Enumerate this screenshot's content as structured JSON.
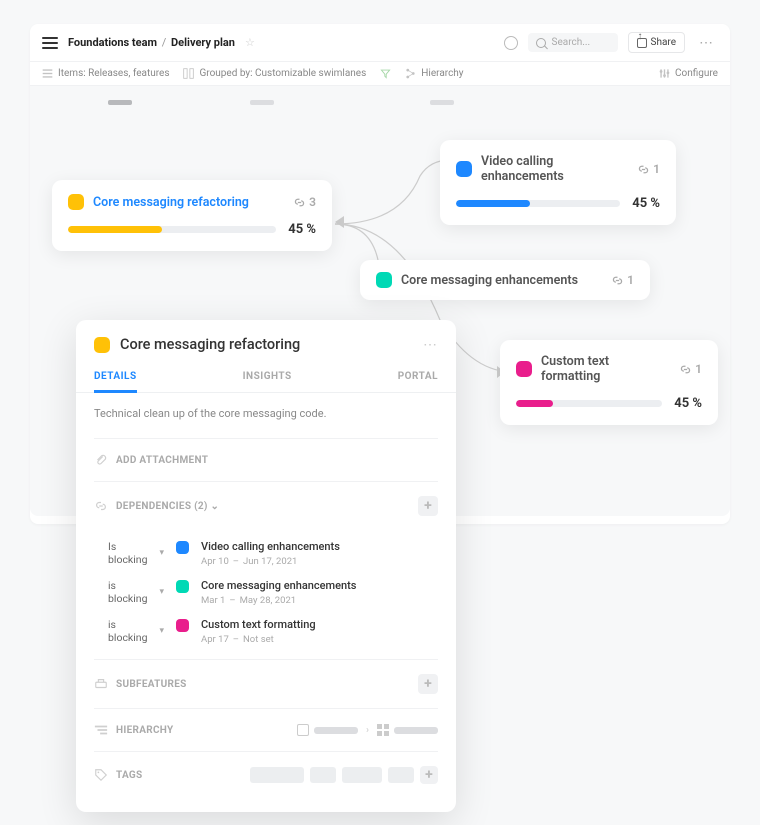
{
  "header": {
    "team": "Foundations team",
    "page": "Delivery plan",
    "search_placeholder": "Search...",
    "share_label": "Share"
  },
  "toolbar": {
    "items_label": "Items: Releases, features",
    "grouped_label": "Grouped by: Customizable swimlanes",
    "hierarchy_label": "Hierarchy",
    "configure_label": "Configure"
  },
  "cards": {
    "core_refactor": {
      "title": "Core messaging refactoring",
      "deps": "3",
      "pct": "45 %",
      "fill": 45
    },
    "video": {
      "title": "Video calling enhancements",
      "deps": "1",
      "pct": "45 %",
      "fill": 45
    },
    "core_enhance": {
      "title": "Core messaging enhancements",
      "deps": "1"
    },
    "custom_text": {
      "title": "Custom text formatting",
      "deps": "1",
      "pct": "45 %",
      "fill": 25
    }
  },
  "panel": {
    "title": "Core messaging refactoring",
    "tabs": {
      "details": "DETAILS",
      "insights": "INSIGHTS",
      "portal": "PORTAL"
    },
    "description": "Technical clean up of the core messaging code.",
    "attach_label": "ADD ATTACHMENT",
    "deps_label": "DEPENDENCIES (2)",
    "subfeatures_label": "SUBFEATURES",
    "hierarchy_label": "HIERARCHY",
    "tags_label": "TAGS",
    "deps": [
      {
        "rel": "Is blocking",
        "color": "blue",
        "name": "Video calling enhancements",
        "start": "Apr 10",
        "end": "Jun 17, 2021"
      },
      {
        "rel": "is blocking",
        "color": "teal",
        "name": "Core messaging enhancements",
        "start": "Mar 1",
        "end": "May 28, 2021"
      },
      {
        "rel": "is blocking",
        "color": "pink",
        "name": "Custom text formatting",
        "start": "Apr 17",
        "end": "Not set"
      }
    ]
  }
}
